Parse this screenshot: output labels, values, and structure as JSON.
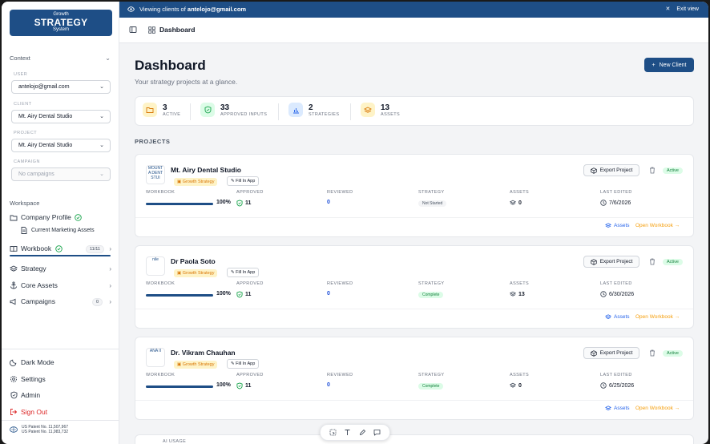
{
  "logo": {
    "line1": "Growth",
    "line2": "STRATEGY",
    "line3": "System"
  },
  "sidebar": {
    "context_label": "Context",
    "user_label": "USER",
    "user_value": "antelojo@gmail.com",
    "client_label": "CLIENT",
    "client_value": "Mt. Airy Dental Studio",
    "project_label": "PROJECT",
    "project_value": "Mt. Airy Dental Studio",
    "campaign_label": "CAMPAIGN",
    "campaign_placeholder": "No campaigns",
    "workspace_label": "Workspace",
    "company_profile": "Company Profile",
    "current_marketing_assets": "Current Marketing Assets",
    "workbook": "Workbook",
    "workbook_badge": "11/11",
    "strategy": "Strategy",
    "core_assets": "Core Assets",
    "campaigns": "Campaigns",
    "campaigns_badge": "0",
    "dark_mode": "Dark Mode",
    "settings": "Settings",
    "admin": "Admin",
    "sign_out": "Sign Out",
    "patent1": "US Patent No. 11,507,967",
    "patent2": "US Patent No. 11,983,732"
  },
  "banner": {
    "prefix": "Viewing clients of",
    "email": "antelojo@gmail.com",
    "exit": "Exit view"
  },
  "topbar": {
    "crumb": "Dashboard"
  },
  "main": {
    "title": "Dashboard",
    "subtitle": "Your strategy projects at a glance.",
    "new_client": "New Client",
    "projects_heading": "PROJECTS"
  },
  "stats": [
    {
      "num": "3",
      "label": "ACTIVE"
    },
    {
      "num": "33",
      "label": "APPROVED INPUTS"
    },
    {
      "num": "2",
      "label": "STRATEGIES"
    },
    {
      "num": "13",
      "label": "ASSETS"
    }
  ],
  "labels": {
    "workbook": "WORKBOOK",
    "approved": "APPROVED",
    "reviewed": "REVIEWED",
    "strategy": "STRATEGY",
    "assets": "ASSETS",
    "last_edited": "LAST EDITED",
    "growth_strategy": "Growth Strategy",
    "fill_in_app": "Fill In App",
    "export_project": "Export Project",
    "active": "Active",
    "assets_link": "Assets",
    "open_workbook": "Open Workbook →",
    "ai_usage": "AI USAGE"
  },
  "projects": [
    {
      "name": "Mt. Airy Dental Studio",
      "logo_text": "MOUNT A DENT STUI",
      "progress": 100,
      "pct": "100%",
      "approved": "11",
      "reviewed": "0",
      "strategy": "Not Started",
      "assets": "0",
      "last_edited": "7/6/2026"
    },
    {
      "name": "Dr Paola Soto",
      "logo_text": "nile",
      "progress": 100,
      "pct": "100%",
      "approved": "11",
      "reviewed": "0",
      "strategy": "Complete",
      "assets": "13",
      "last_edited": "6/30/2026"
    },
    {
      "name": "Dr. Vikram Chauhan",
      "logo_text": "ANA II",
      "progress": 100,
      "pct": "100%",
      "approved": "11",
      "reviewed": "0",
      "strategy": "Complete",
      "assets": "0",
      "last_edited": "6/25/2026"
    }
  ],
  "colors": {
    "brand": "#1e4e86",
    "accent": "#f59e0b",
    "success": "#15803d",
    "danger": "#dc2626"
  }
}
